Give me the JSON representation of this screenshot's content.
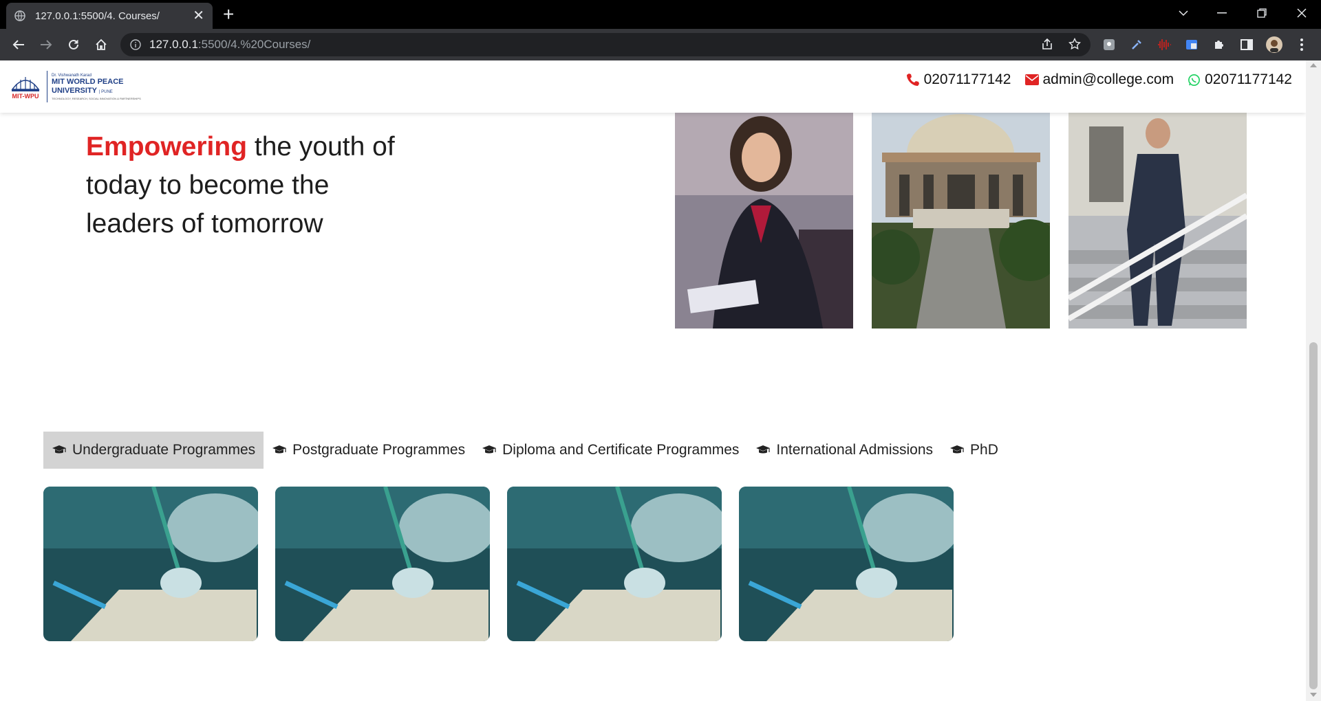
{
  "browser": {
    "tab_title": "127.0.0.1:5500/4. Courses/",
    "url_host": "127.0.0.1",
    "url_rest": ":5500/4.%20Courses/"
  },
  "site": {
    "logo": {
      "small_line": "Dr. Vishwanath Karad",
      "name_line1": "MIT WORLD PEACE",
      "name_line2": "UNIVERSITY",
      "city": "PUNE",
      "mark_text": "MIT-WPU",
      "tagline": "TECHNOLOGY, RESEARCH, SOCIAL INNOVATION & PARTNERSHIPS"
    },
    "contact": {
      "phone": "02071177142",
      "email": "admin@college.com",
      "whatsapp": "02071177142"
    }
  },
  "hero": {
    "accent_word": "Empowering",
    "rest_text": " the youth of today to become the leaders of tomorrow"
  },
  "programme_tabs": [
    {
      "label": "Undergraduate Programmes",
      "active": true
    },
    {
      "label": "Postgraduate Programmes",
      "active": false
    },
    {
      "label": "Diploma and Certificate Programmes",
      "active": false
    },
    {
      "label": "International Admissions",
      "active": false
    },
    {
      "label": "PhD",
      "active": false
    }
  ],
  "colors": {
    "accent": "#e02424",
    "brand_blue": "#1f3f86",
    "active_tab_bg": "#d3d3d3",
    "whatsapp_green": "#25d366"
  },
  "icons": {
    "phone": "phone-icon",
    "email": "envelope-icon",
    "whatsapp": "whatsapp-icon",
    "tab": "graduation-cap-icon"
  }
}
